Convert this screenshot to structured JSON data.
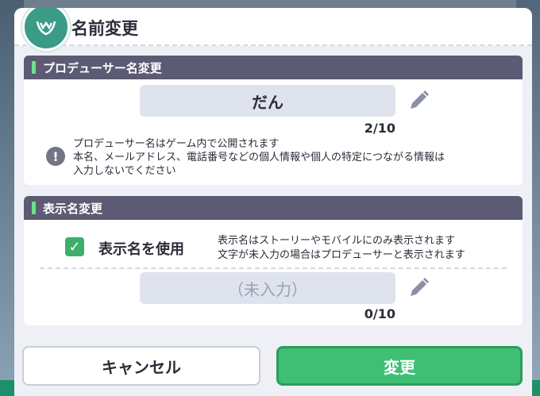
{
  "dialog": {
    "title": "名前変更"
  },
  "producer": {
    "header": "プロデューサー名変更",
    "name_value": "だん",
    "counter": "2/10",
    "info_lines": [
      "プロデューサー名はゲーム内で公開されます",
      "本名、メールアドレス、電話番号などの個人情報や個人の特定につながる情報は",
      "入力しないでください"
    ]
  },
  "display": {
    "header": "表示名変更",
    "checkbox_label": "表示名を使用",
    "checkbox_checked": true,
    "note_lines": [
      "表示名はストーリーやモバイルにのみ表示されます",
      "文字が未入力の場合はプロデューサーと表示されます"
    ],
    "placeholder": "（未入力）",
    "counter": "0/10"
  },
  "buttons": {
    "cancel": "キャンセル",
    "confirm": "変更"
  },
  "colors": {
    "accent_green": "#3fbf74",
    "header_bar": "#5c5b73",
    "field_bg": "#dfe3ee"
  },
  "icons": {
    "emblem": "laurel-emblem-icon",
    "edit": "pencil-icon",
    "info": "exclamation-icon",
    "check": "checkmark-icon"
  }
}
